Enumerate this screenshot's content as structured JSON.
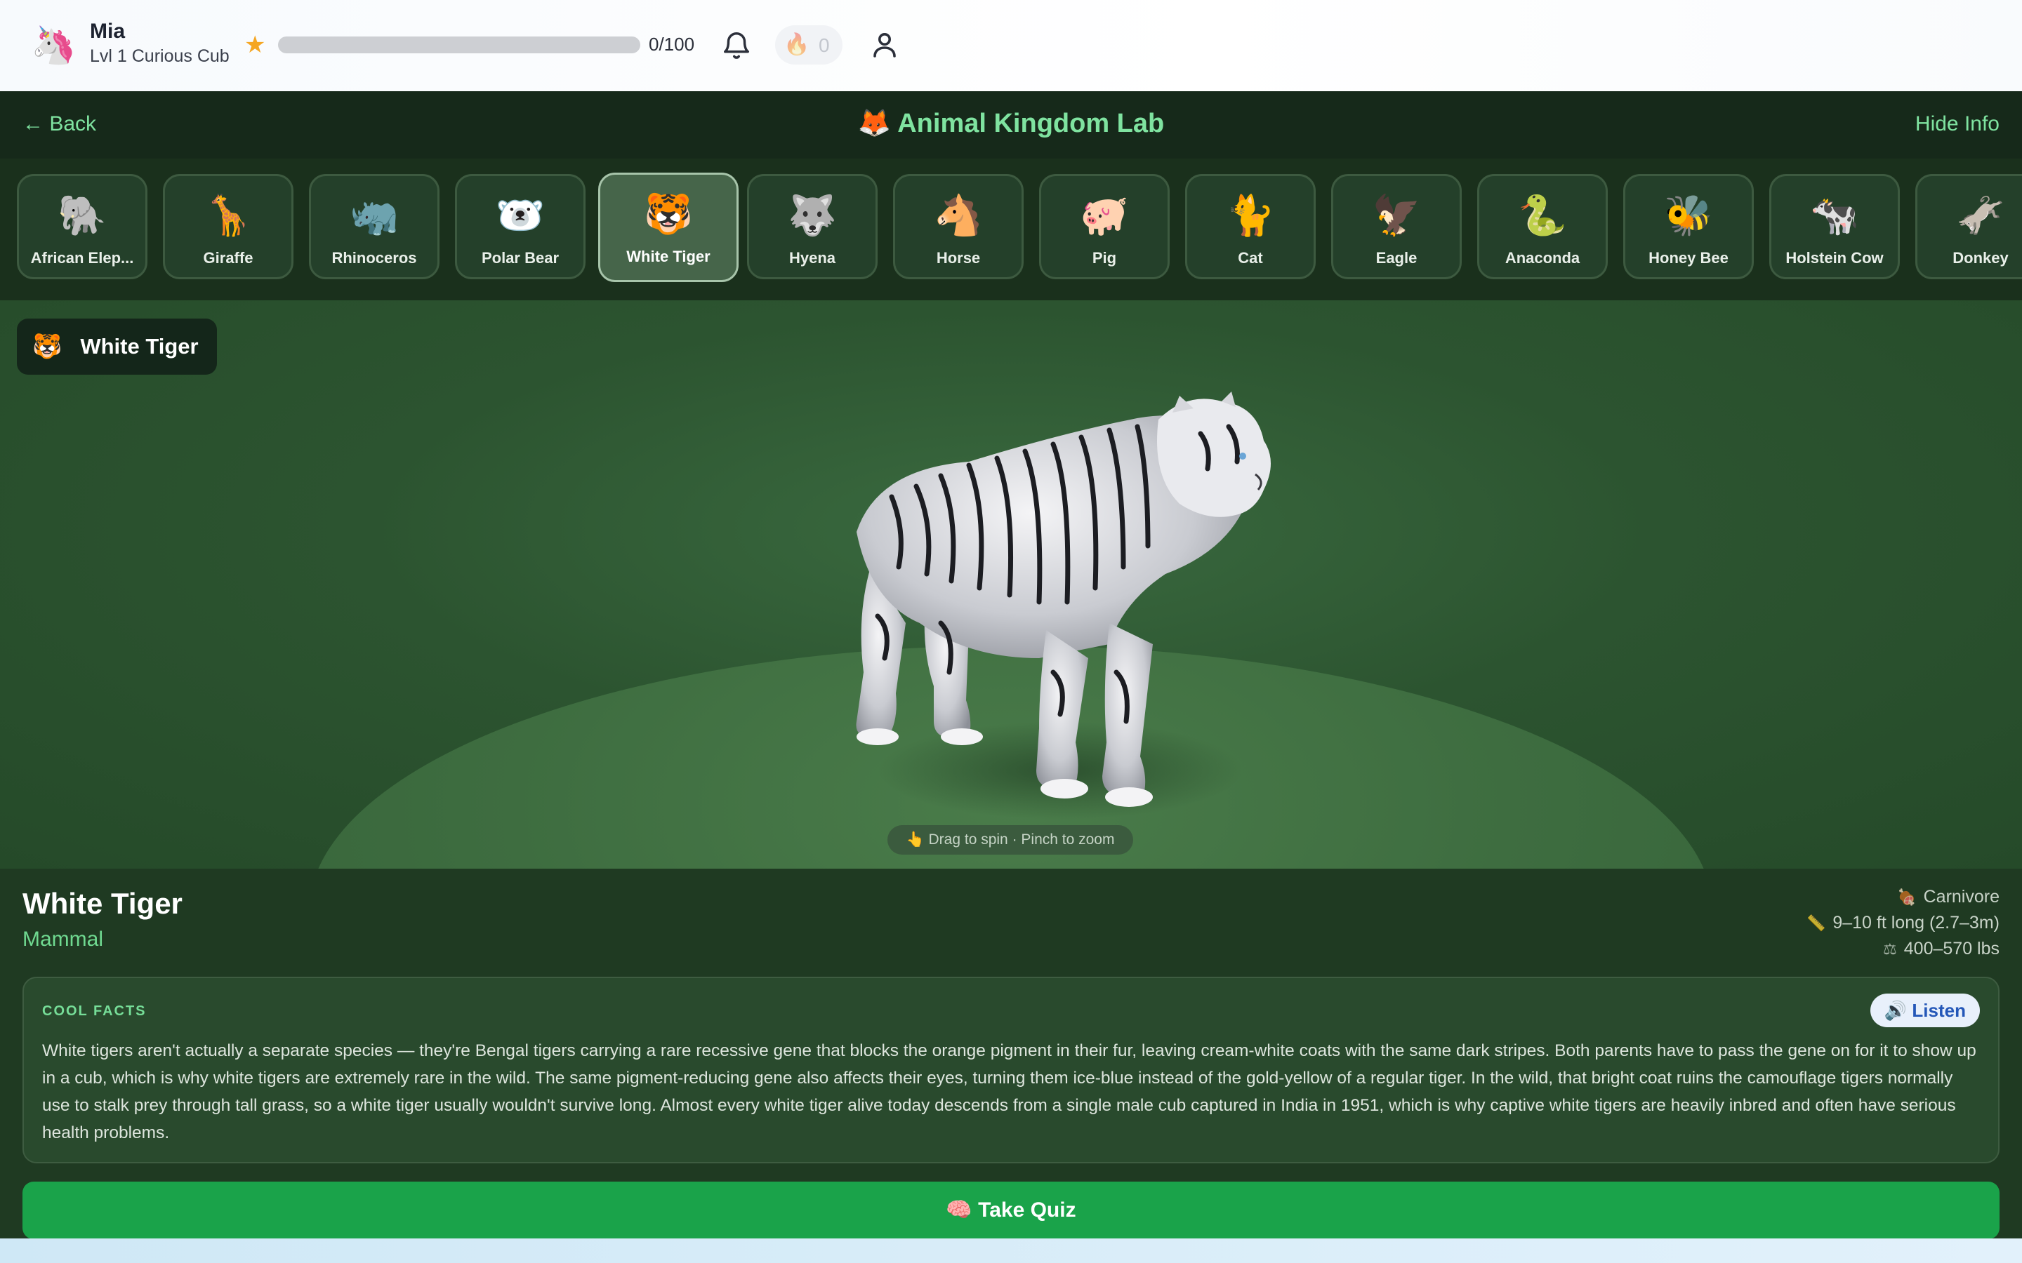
{
  "user": {
    "name": "Mia",
    "level": "Lvl 1 Curious Cub",
    "avatar_icon": "unicorn-icon",
    "xp_text": "0/100",
    "xp_fraction": 0,
    "streak": "0"
  },
  "header": {
    "back_label": "← Back",
    "title_icon": "🦊",
    "title": "Animal Kingdom Lab",
    "hide_info_label": "Hide Info"
  },
  "animals": [
    {
      "label": "African Elep...",
      "emoji": "🐘"
    },
    {
      "label": "Giraffe",
      "emoji": "🦒"
    },
    {
      "label": "Rhinoceros",
      "emoji": "🦏"
    },
    {
      "label": "Polar Bear",
      "emoji": "🐻‍❄️"
    },
    {
      "label": "White Tiger",
      "emoji": "🐯",
      "active": true
    },
    {
      "label": "Hyena",
      "emoji": "🐺"
    },
    {
      "label": "Horse",
      "emoji": "🐴"
    },
    {
      "label": "Pig",
      "emoji": "🐖"
    },
    {
      "label": "Cat",
      "emoji": "🐈"
    },
    {
      "label": "Eagle",
      "emoji": "🦅"
    },
    {
      "label": "Anaconda",
      "emoji": "🐍"
    },
    {
      "label": "Honey Bee",
      "emoji": "🐝"
    },
    {
      "label": "Holstein Cow",
      "emoji": "🐄"
    },
    {
      "label": "Donkey",
      "emoji": "🫏"
    }
  ],
  "viewer": {
    "badge_icon": "🐯",
    "badge_label": "White Tiger",
    "hint": "👆 Drag to spin · Pinch to zoom"
  },
  "info": {
    "name": "White Tiger",
    "class": "Mammal",
    "stats": [
      {
        "icon": "🍖",
        "text": "Carnivore"
      },
      {
        "icon": "📏",
        "text": "9–10 ft long (2.7–3m)"
      },
      {
        "icon": "⚖",
        "text": "400–570 lbs"
      }
    ],
    "facts_heading": "COOL FACTS",
    "listen_label": "🔊 Listen",
    "facts_text": "White tigers aren't actually a separate species — they're Bengal tigers carrying a rare recessive gene that blocks the orange pigment in their fur, leaving cream-white coats with the same dark stripes. Both parents have to pass the gene on for it to show up in a cub, which is why white tigers are extremely rare in the wild. The same pigment-reducing gene also affects their eyes, turning them ice-blue instead of the gold-yellow of a regular tiger. In the wild, that bright coat ruins the camouflage tigers normally use to stalk prey through tall grass, so a white tiger usually wouldn't survive long. Almost every white tiger alive today descends from a single male cub captured in India in 1951, which is why captive white tigers are heavily inbred and often have serious health problems."
  },
  "quiz": {
    "label": "🧠 Take Quiz"
  },
  "colors": {
    "accent_green": "#7fe3a0",
    "quiz_green": "#1aa34a",
    "panel_dark": "#16291a",
    "xp_gold": "#f5a623"
  }
}
